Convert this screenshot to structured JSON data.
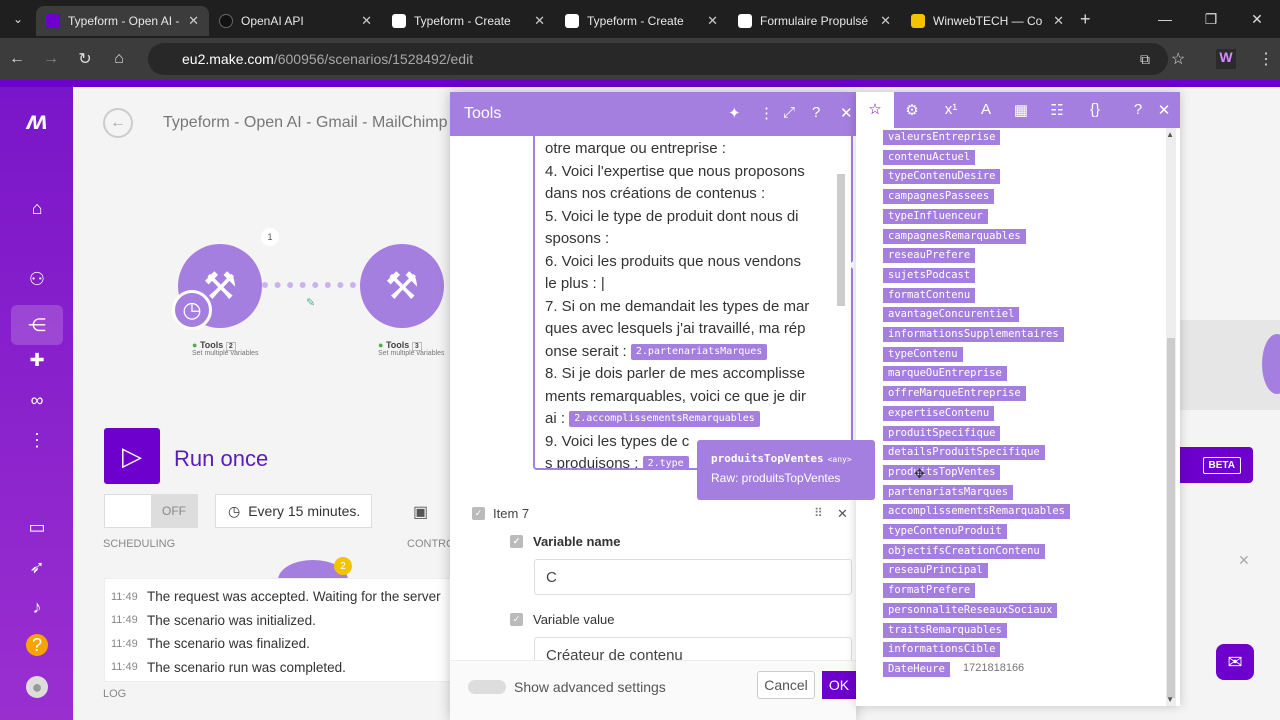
{
  "browser": {
    "tabs": [
      {
        "title": "Typeform - Open AI -",
        "color": "#6d00cc"
      },
      {
        "title": "OpenAI API",
        "color": "#111111"
      },
      {
        "title": "Typeform - Create",
        "color": "#ffffff"
      },
      {
        "title": "Typeform - Create",
        "color": "#ffffff"
      },
      {
        "title": "Formulaire Propulsé",
        "color": "#ffffff"
      },
      {
        "title": "WinwebTECH — Co",
        "color": "#f2c400"
      }
    ],
    "url_host": "eu2.make.com",
    "url_path": "/600956/scenarios/1528492/edit"
  },
  "scenario": {
    "title": "Typeform - Open AI - Gmail - MailChimp",
    "run_label": "Run once",
    "toggle_off": "OFF",
    "schedule": "Every 15 minutes.",
    "scheduling_label": "SCHEDULING",
    "controls_label": "CONTRO",
    "log_label": "LOG",
    "beta": "BETA",
    "node_badge": "1",
    "node_badge2": "2",
    "nodes": [
      {
        "name": "Tools",
        "num": "2",
        "sub": "Set multiple variables"
      },
      {
        "name": "Tools",
        "num": "3",
        "sub": "Set multiple variables"
      }
    ],
    "log": [
      {
        "time": "11:49",
        "text": "The request was accepted. Waiting for the server"
      },
      {
        "time": "11:49",
        "text": "The scenario was initialized."
      },
      {
        "time": "11:49",
        "text": "The scenario was finalized."
      },
      {
        "time": "11:49",
        "text": "The scenario run was completed."
      }
    ]
  },
  "tools": {
    "title": "Tools",
    "text_lines": [
      "otre marque ou entreprise :",
      "4. Voici l'expertise que nous proposons",
      "dans nos créations de contenus :",
      "5. Voici le type de produit dont nous di",
      "sposons :",
      "6. Voici les produits que nous vendons",
      "le plus : |"
    ],
    "line7a": "7. Si on me demandait les types de mar",
    "line7b": "ques avec lesquels j'ai travaillé, ma rép",
    "line7c": "onse serait :",
    "pill1": "2.partenariatsMarques",
    "line8a": "8. Si je dois parler de mes accomplisse",
    "line8b": "ments remarquables, voici ce que je dir",
    "line8c": "ai :",
    "pill2": "2.accomplissementsRemarquables",
    "line9a": "9. Voici les types de c",
    "line9b": "s produisons :",
    "pill3": "2.type",
    "item7": "Item 7",
    "varname_label": "Variable name",
    "varname_value": "C",
    "varvalue_label": "Variable value",
    "varvalue_value": "Créateur de contenu",
    "advanced": "Show advanced settings",
    "cancel": "Cancel",
    "ok": "OK"
  },
  "tooltip": {
    "name": "produitsTopVentes",
    "type": "<any>",
    "raw": "Raw: produitsTopVentes"
  },
  "picker": {
    "variables": [
      "valeursEntreprise",
      "contenuActuel",
      "typeContenuDesire",
      "campagnesPassees",
      "typeInfluenceur",
      "campagnesRemarquables",
      "reseauPrefere",
      "sujetsPodcast",
      "formatContenu",
      "avantageConcurentiel",
      "informationsSupplementaires",
      "typeContenu",
      "marqueOuEntreprise",
      "offreMarqueEntreprise",
      "expertiseContenu",
      "produitSpecifique",
      "detailsProduitSpecifique",
      "produitsTopVentes",
      "partenariatsMarques",
      "accomplissementsRemarquables",
      "typeContenuProduit",
      "objectifsCreationContenu",
      "reseauPrincipal",
      "formatPrefere",
      "personnaliteReseauxSociaux",
      "traitsRemarquables",
      "informationsCible",
      "DateHeure"
    ],
    "date_value": "1721818166"
  },
  "colors": {
    "brand": "#6d00cc",
    "tool": "#a57fe0"
  }
}
